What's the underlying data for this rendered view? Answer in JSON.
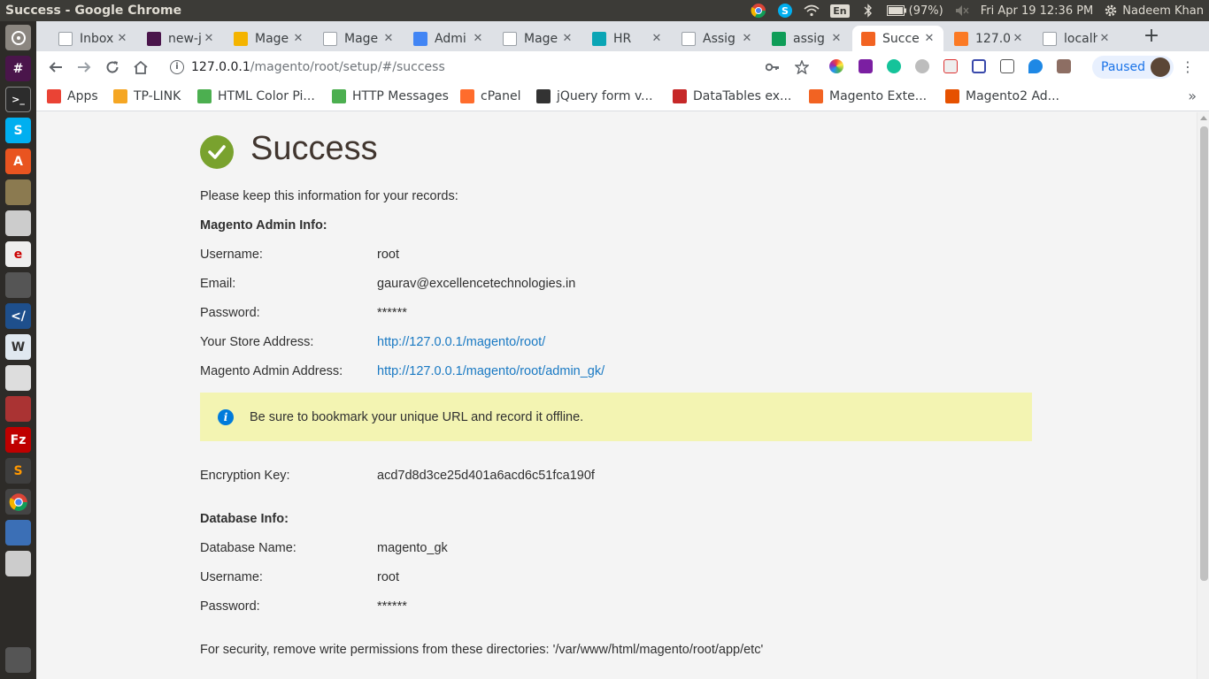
{
  "window": {
    "title": "Success - Google Chrome"
  },
  "top_panel": {
    "language": "En",
    "battery": "(97%)",
    "datetime": "Fri Apr 19 12:36 PM",
    "user": "Nadeem Khan"
  },
  "tabs": [
    {
      "label": "Inbox",
      "favicon": "gmail-icon",
      "color": "#ffffff"
    },
    {
      "label": "new-j",
      "favicon": "slack-icon",
      "color": "#4a154b"
    },
    {
      "label": "Mage",
      "favicon": "slides-icon",
      "color": "#f4b400"
    },
    {
      "label": "Mage",
      "favicon": "page-icon",
      "color": "#ffffff"
    },
    {
      "label": "Admi",
      "favicon": "docs-icon",
      "color": "#4285f4"
    },
    {
      "label": "Mage",
      "favicon": "page-icon",
      "color": "#ffffff"
    },
    {
      "label": "HR",
      "favicon": "xing-icon",
      "color": "#0aa5b5"
    },
    {
      "label": "Assig",
      "favicon": "page-icon",
      "color": "#ffffff"
    },
    {
      "label": "assig",
      "favicon": "drive-icon",
      "color": "#0f9d58"
    },
    {
      "label": "Succe",
      "favicon": "magento-icon",
      "color": "#f26322",
      "active": true
    },
    {
      "label": "127.0",
      "favicon": "xampp-icon",
      "color": "#fb7a24"
    },
    {
      "label": "localh",
      "favicon": "page-icon",
      "color": "#ffffff"
    }
  ],
  "omnibox": {
    "host": "127.0.0.1",
    "path": "/magento/root/setup/#/success"
  },
  "profile": {
    "status": "Paused"
  },
  "bookmarks": [
    {
      "label": "Apps",
      "icon": "apps-grid-icon",
      "color": "#ea4335"
    },
    {
      "label": "TP-LINK",
      "icon": "tplink-icon",
      "color": "#f5a623"
    },
    {
      "label": "HTML Color Pi...",
      "icon": "color-picker-icon",
      "color": "#4caf50"
    },
    {
      "label": "HTTP Messages",
      "icon": "http-icon",
      "color": "#4caf50"
    },
    {
      "label": "cPanel",
      "icon": "cpanel-icon",
      "color": "#ff6c2c"
    },
    {
      "label": "jQuery form v...",
      "icon": "jquery-icon",
      "color": "#333333"
    },
    {
      "label": "DataTables ex...",
      "icon": "datatables-icon",
      "color": "#c62828"
    },
    {
      "label": "Magento Exte...",
      "icon": "magento-icon",
      "color": "#f26322"
    },
    {
      "label": "Magento2 Ad...",
      "icon": "magento2-icon",
      "color": "#e65100"
    }
  ],
  "page": {
    "title": "Success",
    "intro": "Please keep this information for your records:",
    "admin_section": "Magento Admin Info:",
    "admin": {
      "username_label": "Username:",
      "username": "root",
      "email_label": "Email:",
      "email": "gaurav@excellencetechnologies.in",
      "password_label": "Password:",
      "password": "******",
      "store_label": "Your Store Address:",
      "store_url": "http://127.0.0.1/magento/root/",
      "admin_label": "Magento Admin Address:",
      "admin_url": "http://127.0.0.1/magento/root/admin_gk/"
    },
    "notice": "Be sure to bookmark your unique URL and record it offline.",
    "encryption_label": "Encryption Key:",
    "encryption_key": "acd7d8d3ce25d401a6acd6c51fca190f",
    "db_section": "Database Info:",
    "db": {
      "name_label": "Database Name:",
      "name": "magento_gk",
      "username_label": "Username:",
      "username": "root",
      "password_label": "Password:",
      "password": "******"
    },
    "security_note": "For security, remove write permissions from these directories: '/var/www/html/magento/root/app/etc'"
  },
  "colors": {
    "success_green": "#79a22e",
    "link_blue": "#1979c3",
    "notice_bg": "#f3f4b2",
    "info_blue": "#007bdb"
  }
}
